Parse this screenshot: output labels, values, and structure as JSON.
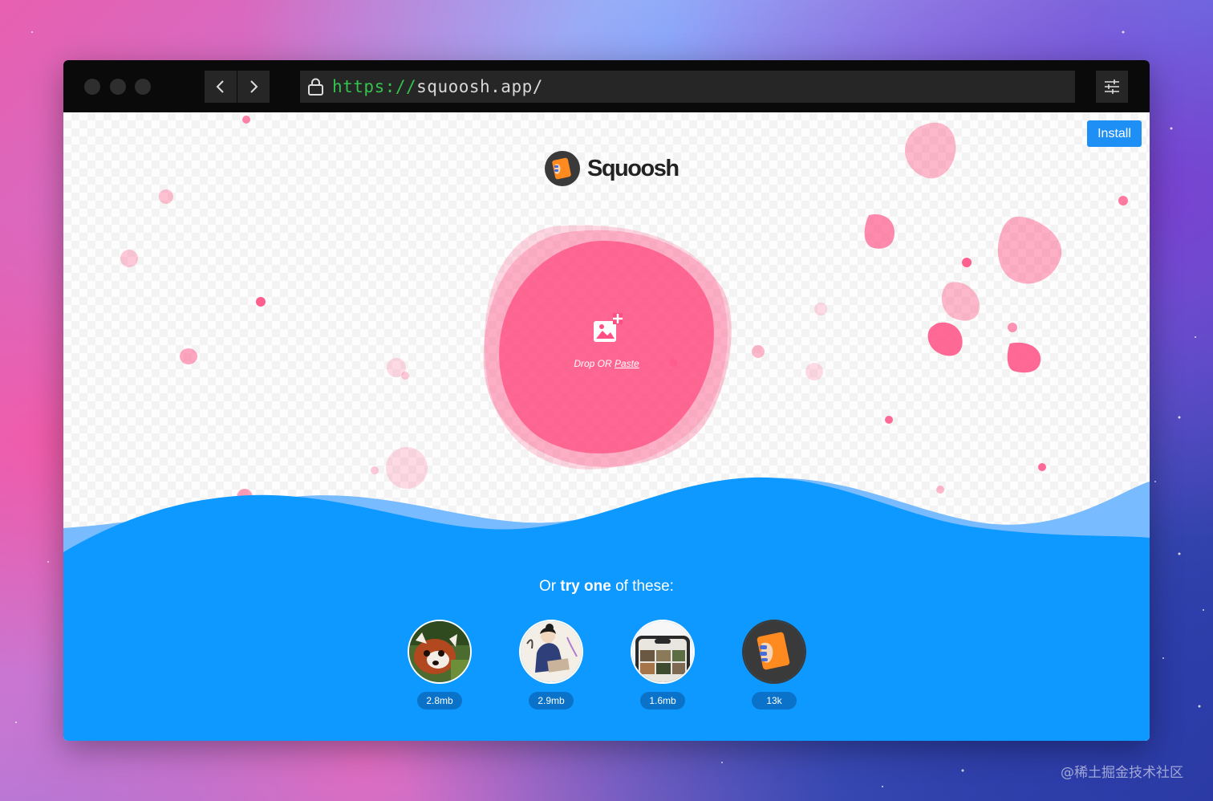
{
  "browser": {
    "url_scheme": "https://",
    "url_host": "squoosh.app/"
  },
  "app": {
    "name": "Squoosh",
    "install_label": "Install",
    "drop_label": "Drop OR",
    "paste_label": "Paste",
    "try_prefix": "Or",
    "try_bold": "try one",
    "try_suffix": "of these:",
    "demos": [
      {
        "name": "red-panda",
        "size": "2.8mb"
      },
      {
        "name": "artwork",
        "size": "2.9mb"
      },
      {
        "name": "device-screen",
        "size": "1.6mb"
      },
      {
        "name": "squoosh-logo",
        "size": "13k"
      }
    ]
  },
  "watermark": "@稀土掘金技术社区",
  "colors": {
    "accent": "#1d8ff5",
    "wave": "#0d99ff",
    "blob": "#ff4f82",
    "url_scheme": "#33c34d"
  }
}
